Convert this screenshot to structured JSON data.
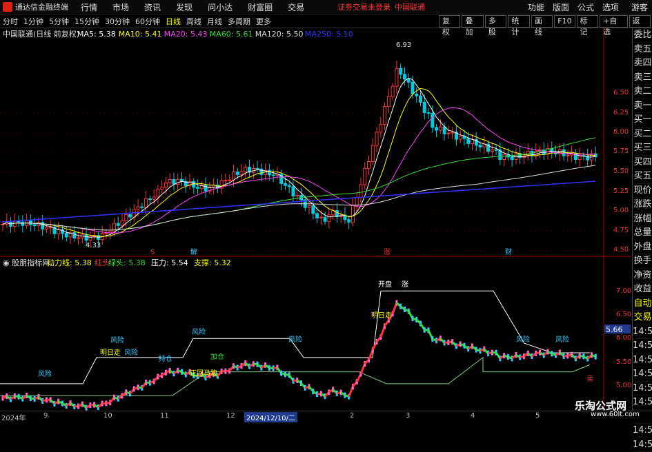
{
  "app": {
    "title": "通达信金融终端",
    "notice": "证劵交易未登录",
    "notice2": "中国联通",
    "guest": "游客"
  },
  "menu": [
    "行情",
    "市场",
    "资讯",
    "发现",
    "问小达",
    "财富圈",
    "交易"
  ],
  "menu_right": [
    "功能",
    "版面",
    "公式",
    "选项"
  ],
  "timeframes": [
    "分时",
    "1分钟",
    "5分钟",
    "15分钟",
    "30分钟",
    "60分钟",
    "日线",
    "周线",
    "月线",
    "多周期",
    "更多"
  ],
  "active_timeframe": "日线",
  "tool_buttons": [
    "复权",
    "叠加",
    "多股",
    "统计",
    "画线",
    "F10",
    "标记",
    "+自选",
    "返回"
  ],
  "main_legend": {
    "stock": "中国联通(日线 前复权)",
    "ma": [
      {
        "label": "MA5: 5.38",
        "color": "#ffffff"
      },
      {
        "label": "MA10: 5.41",
        "color": "#ffff00"
      },
      {
        "label": "MA20: 5.43",
        "color": "#ff44ff"
      },
      {
        "label": "MA60: 5.61",
        "color": "#33dd33"
      },
      {
        "label": "MA120: 5.50",
        "color": "#dddddd"
      },
      {
        "label": "MA250: 5.10",
        "color": "#3333ff"
      }
    ]
  },
  "indicator_legend": {
    "name": "股朋指标网",
    "items": [
      {
        "label": "动力线: 5.38",
        "color": "#ffff00"
      },
      {
        "label": "红头",
        "color": "#ff3333"
      },
      {
        "label": "绿头: 5.38",
        "color": "#33dd33"
      },
      {
        "label": "压力: 5.54",
        "color": "#ffffff"
      },
      {
        "label": "支撑: 5.32",
        "color": "#ffff00"
      }
    ]
  },
  "price_axis": [
    "6.50",
    "6.25",
    "6.00",
    "5.75",
    "5.50",
    "5.25",
    "5.00",
    "4.75",
    "4.50"
  ],
  "ind_axis": [
    "7.00",
    "6.50",
    "6.00",
    "5.50",
    "5.00"
  ],
  "ind_axis_tag": "5.66",
  "high_label": "6.93",
  "low_label": "4.33",
  "side_panel": [
    "委比",
    "卖五",
    "卖四",
    "卖三",
    "卖二",
    "卖一",
    "买一",
    "买二",
    "买三",
    "买四",
    "买五",
    "现价",
    "涨跌",
    "涨幅",
    "总量",
    "外盘",
    "换手",
    "净资",
    "收益",
    "自动",
    "交易",
    "14:5",
    "14:5",
    "14:5",
    "14:5",
    "14:5",
    "14:5",
    "14:5",
    "14:5",
    "14:5"
  ],
  "markers": [
    "S",
    "解",
    "涨",
    "财"
  ],
  "annotations": [
    "风险",
    "风险",
    "风险",
    "风险",
    "风险",
    "风险",
    "风险",
    "明日走",
    "明日走",
    "开盘",
    "涨",
    "正回马跑",
    "加仓",
    "持仓",
    "卖"
  ],
  "dates": [
    "2024年",
    "9",
    "10",
    "11",
    "12",
    "2024/12/10/二",
    "2",
    "3",
    "4",
    "5"
  ],
  "watermark": "乐淘公式网",
  "watermark_url": "www.60lt.com",
  "colors": {
    "up": "#ff3333",
    "down": "#00ccdd",
    "ma5": "#ffffff",
    "ma10": "#ffff00",
    "ma20": "#ff44ff",
    "ma60": "#33dd33",
    "ma120": "#dddddd",
    "ma250": "#3333ff",
    "grid": "#550000"
  }
}
